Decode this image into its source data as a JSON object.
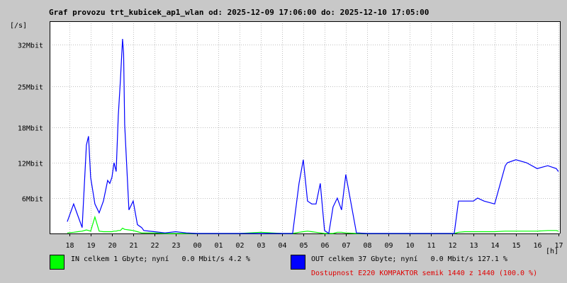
{
  "chart_data": {
    "type": "line",
    "title": "Graf provozu trt_kubicek_ap1_wlan od: 2025-12-09 17:06:00 do: 2025-12-10 17:05:00",
    "ylabel": "[/s]",
    "xlabel": "[h]",
    "ylim": [
      0,
      36
    ],
    "y_unit": "Mbit",
    "y_ticks": [
      {
        "value": 6,
        "label": "6Mbit"
      },
      {
        "value": 12,
        "label": "12Mbit"
      },
      {
        "value": 18,
        "label": "18Mbit"
      },
      {
        "value": 25,
        "label": "25Mbit"
      },
      {
        "value": 32,
        "label": "32Mbit"
      }
    ],
    "x_ticks": [
      "18",
      "19",
      "20",
      "21",
      "22",
      "23",
      "00",
      "01",
      "02",
      "03",
      "04",
      "05",
      "06",
      "07",
      "08",
      "09",
      "10",
      "11",
      "12",
      "13",
      "14",
      "15",
      "16",
      "17"
    ],
    "grid": true,
    "x_hours": [
      17.9,
      18.2,
      18.4,
      18.6,
      18.8,
      18.9,
      19.0,
      19.2,
      19.4,
      19.6,
      19.8,
      19.9,
      20.0,
      20.1,
      20.2,
      20.3,
      20.4,
      20.5,
      20.55,
      20.6,
      20.8,
      21.0,
      21.2,
      21.4,
      21.5,
      22.0,
      22.5,
      23.0,
      23.5,
      24.0,
      25.0,
      26.0,
      27.0,
      28.0,
      28.5,
      28.8,
      29.0,
      29.2,
      29.4,
      29.6,
      29.8,
      30.0,
      30.2,
      30.4,
      30.6,
      30.8,
      31.0,
      31.5,
      32.0,
      33.0,
      34.0,
      35.0,
      36.0,
      36.1,
      36.3,
      36.6,
      36.8,
      37.0,
      37.2,
      37.5,
      38.0,
      38.5,
      38.6,
      39.0,
      39.5,
      40.0,
      40.5,
      40.9,
      41.0
    ],
    "series": [
      {
        "name": "IN",
        "color": "#00ff00",
        "values": [
          0.1,
          0.2,
          0.3,
          0.4,
          0.6,
          0.5,
          0.4,
          2.8,
          0.4,
          0.3,
          0.3,
          0.3,
          0.3,
          0.4,
          0.4,
          0.5,
          0.5,
          0.9,
          0.8,
          0.7,
          0.6,
          0.5,
          0.3,
          0.1,
          0.1,
          0.1,
          0.0,
          0.0,
          0.0,
          0.0,
          0.0,
          0.0,
          0.2,
          0.0,
          0.0,
          0.2,
          0.3,
          0.4,
          0.3,
          0.2,
          0.1,
          0.0,
          0.0,
          0.0,
          0.2,
          0.2,
          0.1,
          0.0,
          0.0,
          0.0,
          0.0,
          0.0,
          0.0,
          0.0,
          0.2,
          0.3,
          0.3,
          0.3,
          0.3,
          0.3,
          0.3,
          0.4,
          0.4,
          0.4,
          0.4,
          0.4,
          0.5,
          0.5,
          0.4
        ]
      },
      {
        "name": "OUT",
        "color": "#0000ff",
        "values": [
          2.0,
          5.0,
          3.0,
          1.0,
          15.0,
          16.5,
          9.5,
          5.0,
          3.5,
          5.5,
          9.0,
          8.5,
          9.5,
          12.0,
          10.5,
          20.0,
          26.0,
          33.0,
          30.5,
          18.5,
          4.0,
          5.5,
          1.5,
          1.0,
          0.5,
          0.3,
          0.1,
          0.3,
          0.1,
          0.0,
          0.0,
          0.0,
          0.0,
          0.0,
          0.0,
          8.5,
          12.5,
          5.5,
          5.0,
          5.0,
          8.5,
          0.5,
          0.0,
          4.5,
          6.0,
          4.0,
          10.0,
          0.1,
          0.0,
          0.0,
          0.0,
          0.0,
          0.0,
          0.0,
          5.5,
          5.5,
          5.5,
          5.5,
          6.0,
          5.5,
          5.0,
          11.5,
          12.0,
          12.5,
          12.0,
          11.0,
          11.5,
          11.0,
          10.5
        ]
      }
    ]
  },
  "legend": {
    "in": {
      "color": "#00ff00",
      "text": "IN celkem 1 Gbyte; nyní   0.0 Mbit/s 4.2 %"
    },
    "out": {
      "color": "#0000ff",
      "text": "OUT celkem 37 Gbyte; nyní   0.0 Mbit/s 127.1 %"
    }
  },
  "availability": {
    "text": "Dostupnost E220 KOMPAKTOR semik 1440 z 1440 (100.0 %)",
    "color": "#e00000"
  }
}
